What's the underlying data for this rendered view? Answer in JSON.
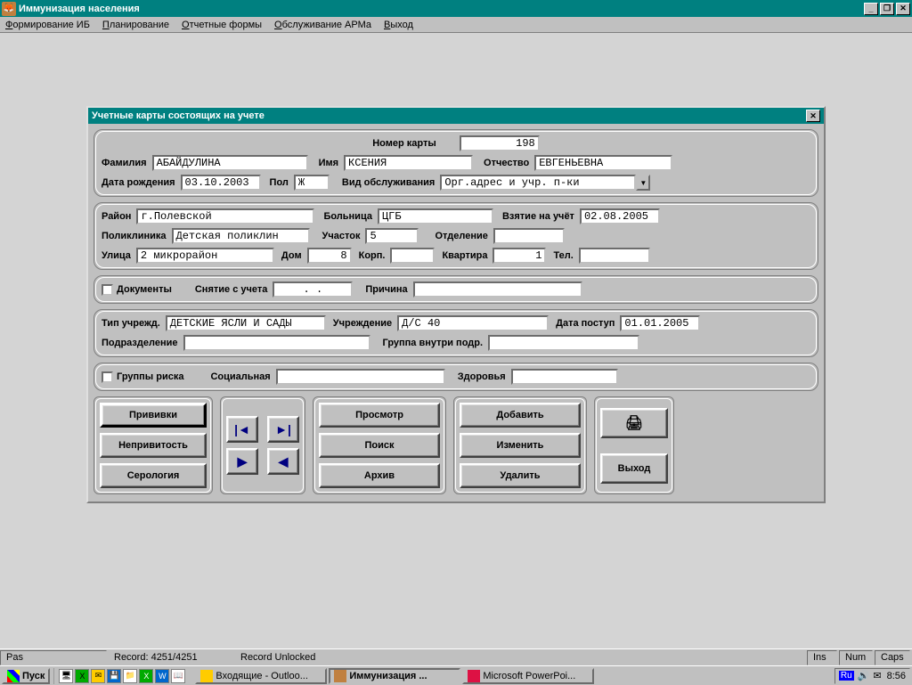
{
  "app": {
    "title": "Иммунизация населения",
    "menu": [
      "Формирование ИБ",
      "Планирование",
      "Отчетные формы",
      "Обслуживание АРМа",
      "Выход"
    ]
  },
  "dialog": {
    "title": "Учетные карты состоящих на учете",
    "labels": {
      "card_no": "Номер карты",
      "surname": "Фамилия",
      "name": "Имя",
      "patronymic": "Отчество",
      "dob": "Дата рождения",
      "sex": "Пол",
      "service_type": "Вид обслуживания",
      "district": "Район",
      "hospital": "Больница",
      "registered": "Взятие на учёт",
      "clinic": "Поликлиника",
      "section": "Участок",
      "department": "Отделение",
      "street": "Улица",
      "house": "Дом",
      "building": "Корп.",
      "flat": "Квартира",
      "phone": "Тел.",
      "documents": "Документы",
      "dereg": "Снятие с учета",
      "reason": "Причина",
      "inst_type": "Тип учрежд.",
      "institution": "Учреждение",
      "adm_date": "Дата поступ",
      "subdivision": "Подразделение",
      "group_in": "Группа внутри подр.",
      "risk_groups": "Группы риска",
      "social": "Социальная",
      "health": "Здоровья"
    },
    "values": {
      "card_no": "198",
      "surname": "АБАЙДУЛИНА",
      "name": "КСЕНИЯ",
      "patronymic": "ЕВГЕНЬЕВНА",
      "dob": "03.10.2003",
      "sex": "Ж",
      "service_type": "Орг.адрес и учр. п-ки",
      "district": "г.Полевской",
      "hospital": "ЦГБ",
      "registered": "02.08.2005",
      "clinic": "Детская поликлин",
      "section": "5",
      "department": "",
      "street": "2 микрорайон",
      "house": "8",
      "building": "",
      "flat": "1",
      "phone": "",
      "dereg_date": "  .  .",
      "reason": "",
      "inst_type": "ДЕТСКИЕ ЯСЛИ И САДЫ",
      "institution": "Д/С 40",
      "adm_date": "01.01.2005",
      "subdivision": "",
      "group_in": "",
      "social": "",
      "health": ""
    },
    "buttons": {
      "vaccinations": "Прививки",
      "unvaccinated": "Непривитость",
      "serology": "Серология",
      "view": "Просмотр",
      "search": "Поиск",
      "archive": "Архив",
      "add": "Добавить",
      "edit": "Изменить",
      "delete": "Удалить",
      "exit": "Выход"
    }
  },
  "status": {
    "pas": "Pas",
    "record": "Record: 4251/4251",
    "lock": "Record Unlocked",
    "ins": "Ins",
    "num": "Num",
    "caps": "Caps"
  },
  "taskbar": {
    "start": "Пуск",
    "tasks": [
      "Входящие - Outloo...",
      "Иммунизация ...",
      "Microsoft PowerPoi..."
    ],
    "lang": "Ru",
    "clock": "8:56"
  }
}
